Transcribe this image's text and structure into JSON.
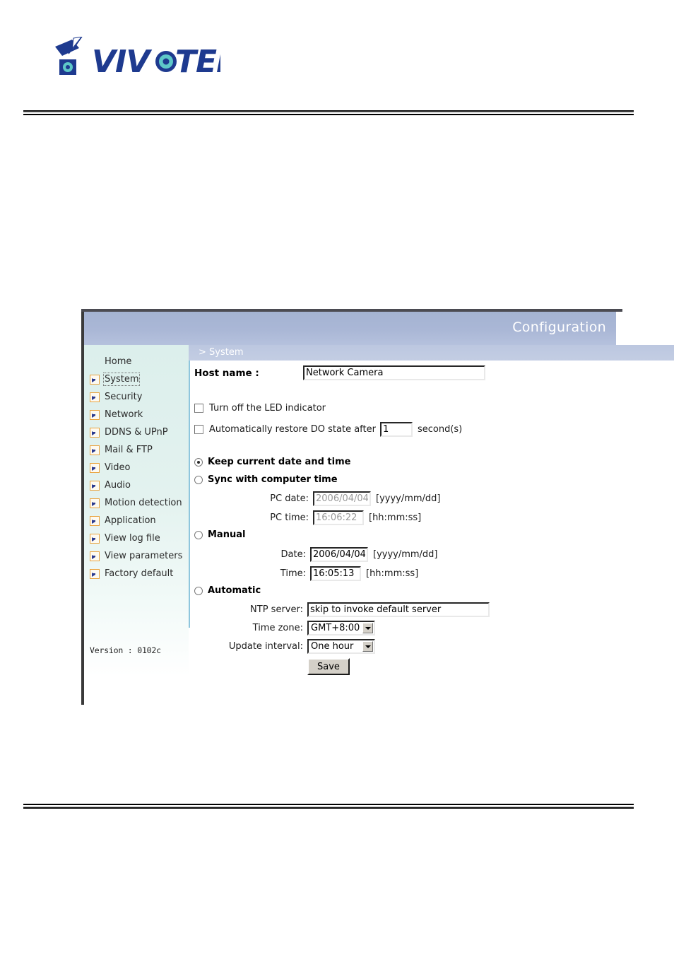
{
  "brand": {
    "logo_text": "VIVOTEK",
    "logo_icon": "camera-icon"
  },
  "panel": {
    "header_title": "Configuration",
    "breadcrumb": "> System"
  },
  "sidebar": {
    "items": [
      {
        "label": "Home",
        "has_bullet": false,
        "selected": false
      },
      {
        "label": "System",
        "has_bullet": true,
        "selected": true
      },
      {
        "label": "Security",
        "has_bullet": true,
        "selected": false
      },
      {
        "label": "Network",
        "has_bullet": true,
        "selected": false
      },
      {
        "label": "DDNS & UPnP",
        "has_bullet": true,
        "selected": false
      },
      {
        "label": "Mail & FTP",
        "has_bullet": true,
        "selected": false
      },
      {
        "label": "Video",
        "has_bullet": true,
        "selected": false
      },
      {
        "label": "Audio",
        "has_bullet": true,
        "selected": false
      },
      {
        "label": "Motion detection",
        "has_bullet": true,
        "selected": false
      },
      {
        "label": "Application",
        "has_bullet": true,
        "selected": false
      },
      {
        "label": "View log file",
        "has_bullet": true,
        "selected": false
      },
      {
        "label": "View parameters",
        "has_bullet": true,
        "selected": false
      },
      {
        "label": "Factory default",
        "has_bullet": true,
        "selected": false
      }
    ],
    "version": "Version : 0102c"
  },
  "form": {
    "host_name_label": "Host name :",
    "host_name_value": "Network Camera",
    "led_checkbox_label": "Turn off the LED indicator",
    "led_checkbox_checked": false,
    "do_restore_label_before": "Automatically restore DO state after",
    "do_restore_value": "1",
    "do_restore_label_after": "second(s)",
    "do_restore_checked": false,
    "time_mode": "keep",
    "radio_keep_label": "Keep current date and time",
    "radio_sync_label": "Sync with computer time",
    "radio_manual_label": "Manual",
    "radio_automatic_label": "Automatic",
    "pc_date_label": "PC date:",
    "pc_date_value": "2006/04/04",
    "pc_date_hint": "[yyyy/mm/dd]",
    "pc_time_label": "PC time:",
    "pc_time_value": "16:06:22",
    "pc_time_hint": "[hh:mm:ss]",
    "manual_date_label": "Date:",
    "manual_date_value": "2006/04/04",
    "manual_date_hint": "[yyyy/mm/dd]",
    "manual_time_label": "Time:",
    "manual_time_value": "16:05:13",
    "manual_time_hint": "[hh:mm:ss]",
    "ntp_server_label": "NTP server:",
    "ntp_server_value": "skip to invoke default server",
    "time_zone_label": "Time zone:",
    "time_zone_value": "GMT+8:00",
    "update_interval_label": "Update interval:",
    "update_interval_value": "One hour",
    "save_label": "Save"
  },
  "colors": {
    "header_blue": "#a8b5d4",
    "breadcrumb_blue": "#bfc9e1",
    "sidebar_mint": "#dcefec",
    "divider_blue": "#8fc6dd",
    "bullet_orange": "#e9a23c",
    "bullet_arrow_blue": "#2b3a8f",
    "logo_blue": "#1e3a8f",
    "logo_teal": "#5ec8c8"
  }
}
